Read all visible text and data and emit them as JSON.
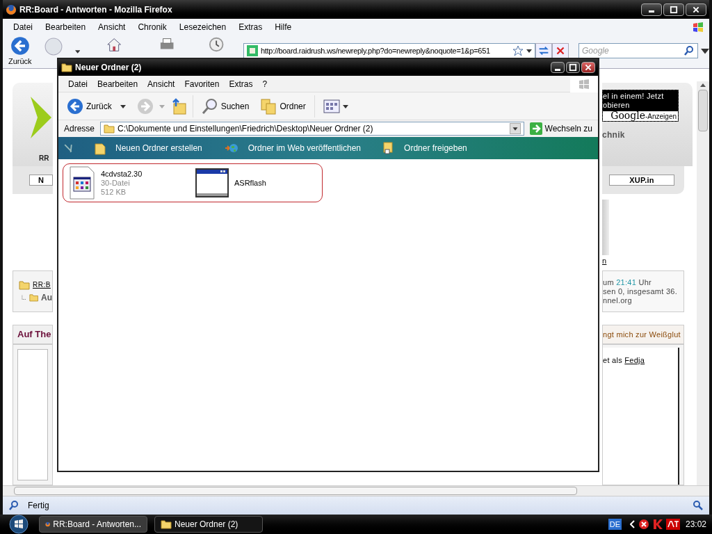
{
  "firefox": {
    "title": "RR:Board - Antworten - Mozilla Firefox",
    "menu": [
      "Datei",
      "Bearbeiten",
      "Ansicht",
      "Chronik",
      "Lesezeichen",
      "Extras",
      "Hilfe"
    ],
    "back_label": "Zurück",
    "url": "http://board.raidrush.ws/newreply.php?do=newreply&noquote=1&p=651",
    "search_placeholder": "Google",
    "status": "Fertig"
  },
  "page": {
    "left": {
      "logo_text": "RR",
      "nav_button": "N",
      "breadcrumb": [
        "RR:B",
        "Au"
      ],
      "section_title": "Auf The"
    },
    "right": {
      "ad_lines": [
        "el in einem! Jetzt",
        "obieren"
      ],
      "ad_brand": "Google",
      "ad_suffix": "-Anzeigen",
      "header_word": "chnik",
      "nav_button": "XUP.in",
      "link": "n",
      "info_time_before": "um ",
      "info_time": "21:41",
      "info_time_after": " Uhr",
      "info_lines": [
        "sen 0, insgesamt 36.",
        "nnel.org"
      ],
      "section_title": "ngt mich zur Weißglut",
      "login_before": "et als ",
      "login_user": "Fedja"
    }
  },
  "explorer": {
    "title": "Neuer Ordner (2)",
    "menu": [
      "Datei",
      "Bearbeiten",
      "Ansicht",
      "Favoriten",
      "Extras",
      "?"
    ],
    "back_label": "Zurück",
    "search_label": "Suchen",
    "folders_label": "Ordner",
    "address_label": "Adresse",
    "path": "C:\\Dokumente und Einstellungen\\Friedrich\\Desktop\\Neuer Ordner (2)",
    "go_label": "Wechseln zu",
    "tasks": [
      {
        "label": "Neuen Ordner erstellen",
        "kind": "new-folder"
      },
      {
        "label": "Ordner im Web veröffentlichen",
        "kind": "publish"
      },
      {
        "label": "Ordner freigeben",
        "kind": "share"
      }
    ],
    "files": [
      {
        "name": "4cdvsta2.30",
        "type": "30-Datei",
        "size": "512 KB",
        "kind": "document"
      },
      {
        "name": "ASRflash",
        "kind": "application"
      }
    ]
  },
  "taskbar": {
    "tasks": [
      {
        "label": "RR:Board - Antworten...",
        "kind": "browser",
        "selected": false
      },
      {
        "label": "Neuer Ordner (2)",
        "kind": "folder",
        "selected": true
      }
    ],
    "language": "DE",
    "clock": "23:02"
  }
}
